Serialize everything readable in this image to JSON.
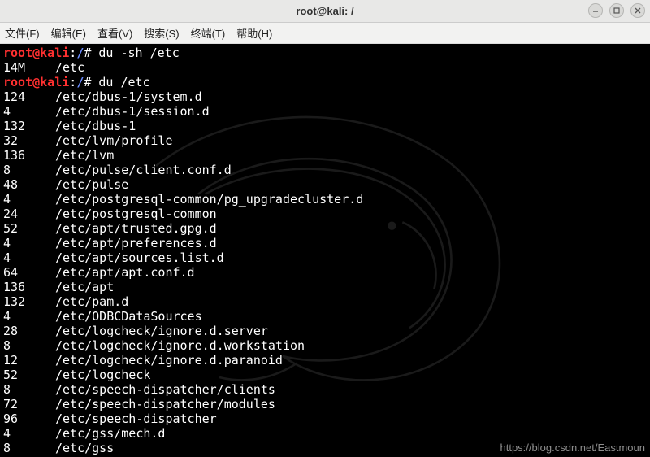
{
  "window": {
    "title": "root@kali: /",
    "buttons": {
      "min": "minimize",
      "max": "maximize",
      "close": "close"
    }
  },
  "menubar": {
    "items": [
      {
        "label": "文件(F)"
      },
      {
        "label": "编辑(E)"
      },
      {
        "label": "查看(V)"
      },
      {
        "label": "搜索(S)"
      },
      {
        "label": "终端(T)"
      },
      {
        "label": "帮助(H)"
      }
    ]
  },
  "prompt": {
    "userhost": "root@kali",
    "colon": ":",
    "cwd": "/",
    "hash": "# "
  },
  "commands": {
    "cmd1": "du -sh /etc",
    "cmd2": "du /etc"
  },
  "output1": {
    "size": "14M",
    "path": "/etc"
  },
  "rows": [
    {
      "size": "124",
      "path": "/etc/dbus-1/system.d"
    },
    {
      "size": "4",
      "path": "/etc/dbus-1/session.d"
    },
    {
      "size": "132",
      "path": "/etc/dbus-1"
    },
    {
      "size": "32",
      "path": "/etc/lvm/profile"
    },
    {
      "size": "136",
      "path": "/etc/lvm"
    },
    {
      "size": "8",
      "path": "/etc/pulse/client.conf.d"
    },
    {
      "size": "48",
      "path": "/etc/pulse"
    },
    {
      "size": "4",
      "path": "/etc/postgresql-common/pg_upgradecluster.d"
    },
    {
      "size": "24",
      "path": "/etc/postgresql-common"
    },
    {
      "size": "52",
      "path": "/etc/apt/trusted.gpg.d"
    },
    {
      "size": "4",
      "path": "/etc/apt/preferences.d"
    },
    {
      "size": "4",
      "path": "/etc/apt/sources.list.d"
    },
    {
      "size": "64",
      "path": "/etc/apt/apt.conf.d"
    },
    {
      "size": "136",
      "path": "/etc/apt"
    },
    {
      "size": "132",
      "path": "/etc/pam.d"
    },
    {
      "size": "4",
      "path": "/etc/ODBCDataSources"
    },
    {
      "size": "28",
      "path": "/etc/logcheck/ignore.d.server"
    },
    {
      "size": "8",
      "path": "/etc/logcheck/ignore.d.workstation"
    },
    {
      "size": "12",
      "path": "/etc/logcheck/ignore.d.paranoid"
    },
    {
      "size": "52",
      "path": "/etc/logcheck"
    },
    {
      "size": "8",
      "path": "/etc/speech-dispatcher/clients"
    },
    {
      "size": "72",
      "path": "/etc/speech-dispatcher/modules"
    },
    {
      "size": "96",
      "path": "/etc/speech-dispatcher"
    },
    {
      "size": "4",
      "path": "/etc/gss/mech.d"
    },
    {
      "size": "8",
      "path": "/etc/gss"
    }
  ],
  "watermark": "https://blog.csdn.net/Eastmoun"
}
